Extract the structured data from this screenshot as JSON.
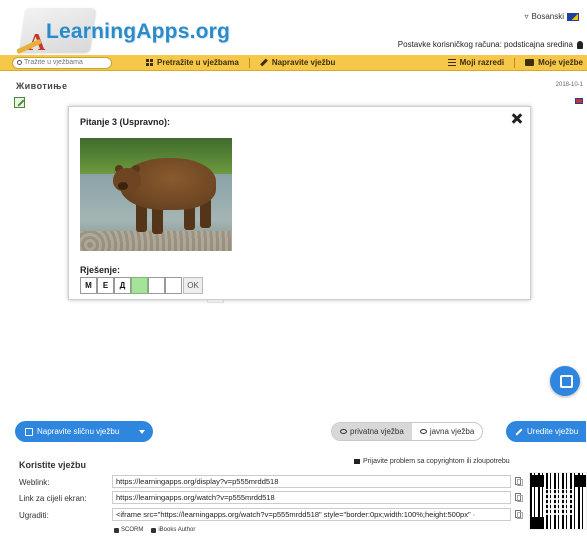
{
  "header": {
    "logo_text": "LearningApps.org",
    "language": "Bosanski",
    "account_text": "Postavke korisničkog računa: podsticajna sredina"
  },
  "navbar": {
    "search_placeholder": "Tražite u vježbama",
    "browse_label": "Pretražite u vježbama",
    "create_label": "Napravite vježbu",
    "classes_label": "Moji razredi",
    "my_apps_label": "Moje vježbe"
  },
  "app": {
    "title": "Животиње",
    "date": "2018-10-1"
  },
  "modal": {
    "question_title": "Pitanje 3 (Uspravno):",
    "answer_label": "Rješenje:",
    "answer_cells": [
      "М",
      "Е",
      "Д",
      "",
      "",
      ""
    ],
    "ok_label": "OK"
  },
  "actions": {
    "similar_label": "Napravite sličnu vježbu",
    "private_label": "privatna vježba",
    "public_label": "javna vježba",
    "edit_label": "Uredite vježbu"
  },
  "usage": {
    "title": "Koristite vježbu",
    "report_label": "Prijavite problem sa copyrightom ili zloupotrebu",
    "weblink_label": "Weblink:",
    "weblink_value": "https://learningapps.org/display?v=p555mrdd518",
    "fullscreen_label": "Link za cijeli ekran:",
    "fullscreen_value": "https://learningapps.org/watch?v=p555mrdd518",
    "embed_label": "Ugraditi:",
    "embed_value": "<iframe src=\"https://learningapps.org/watch?v=p555mrdd518\" style=\"border:0px;width:100%;height:500px\" ·",
    "scorm_label": "SCORM",
    "ibooks_label": "iBooks Author"
  },
  "colors": {
    "navbar": "#f7c74a",
    "primary_button": "#2e86de",
    "answer_fill": "#a6e39a"
  }
}
